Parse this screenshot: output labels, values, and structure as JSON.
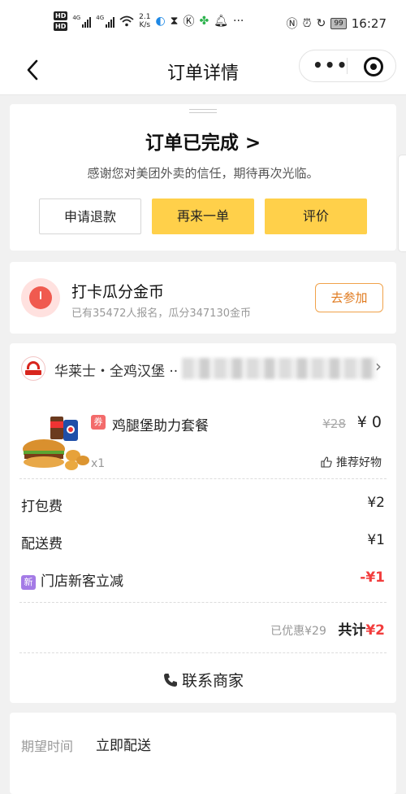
{
  "status_bar": {
    "hd1": "HD",
    "hd2": "HD",
    "signal1": "4G",
    "signal2": "4G",
    "speed_value": "2.1",
    "speed_unit": "K/s",
    "battery": "99",
    "time": "16:27",
    "icons": [
      "wifi-icon",
      "browser-icon",
      "hourglass-icon",
      "k-icon",
      "pinwheel-icon",
      "bell-icon",
      "more-dots",
      "nfc-icon",
      "alarm-icon",
      "rotate-icon"
    ]
  },
  "nav": {
    "back": "<",
    "title": "订单详情",
    "more": "•••"
  },
  "status_card": {
    "title": "订单已完成 >",
    "description": "感谢您对美团外卖的信任，期待再次光临。",
    "buttons": {
      "refund": "申请退款",
      "reorder": "再来一单",
      "review": "评价"
    }
  },
  "promo": {
    "title": "打卡瓜分金币",
    "subtitle": "已有35472人报名，瓜分347130金币",
    "join": "去参加"
  },
  "order": {
    "shop_name": "华莱士・全鸡汉堡 ··",
    "item": {
      "tag": "券",
      "name": "鸡腿堡助力套餐",
      "original_price": "¥28",
      "price": "¥ 0",
      "quantity": "x1",
      "recommend": "推荐好物"
    },
    "fees": [
      {
        "label": "打包费",
        "amount": "¥2"
      },
      {
        "label": "配送费",
        "amount": "¥1"
      }
    ],
    "discount": {
      "tag": "新",
      "label": "门店新客立减",
      "amount": "-¥1"
    },
    "total": {
      "saved": "已优惠¥29",
      "label": "共计",
      "amount": "¥2"
    },
    "contact": "联系商家"
  },
  "delivery": {
    "time_label": "期望时间",
    "time_value": "立即配送"
  },
  "colors": {
    "accent_yellow": "#ffd04a",
    "price_red": "#f23d3d",
    "join_orange": "#e07a1e"
  }
}
